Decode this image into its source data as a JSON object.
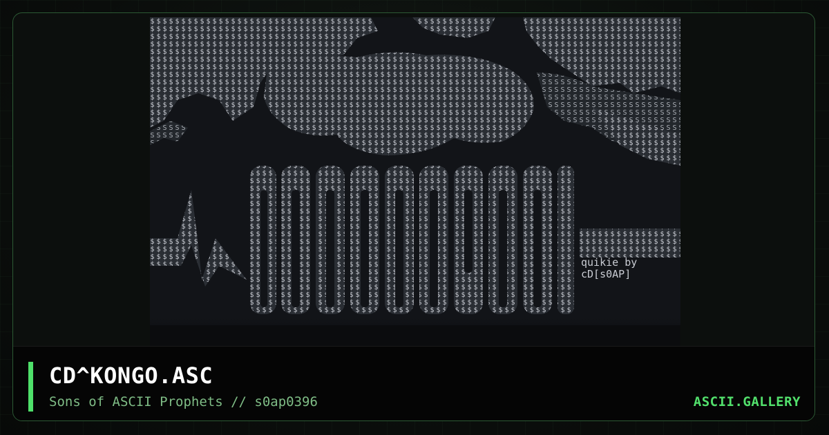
{
  "card": {
    "title": "CD^KONGO.ASC",
    "subtitle": "Sons of ASCII Prophets // s0ap0396",
    "brand": "ASCII.GALLERY"
  },
  "artwork": {
    "signature_line1": "quikie by",
    "signature_line2": "cD[s0AP]"
  },
  "colors": {
    "accent": "#4ee06a",
    "frame_border": "#2c5a34",
    "subtitle": "#7fbd86",
    "brand": "#52e06c",
    "ascii_glyph": "#c9ccd3",
    "artwork_bg": "#0e1014"
  }
}
